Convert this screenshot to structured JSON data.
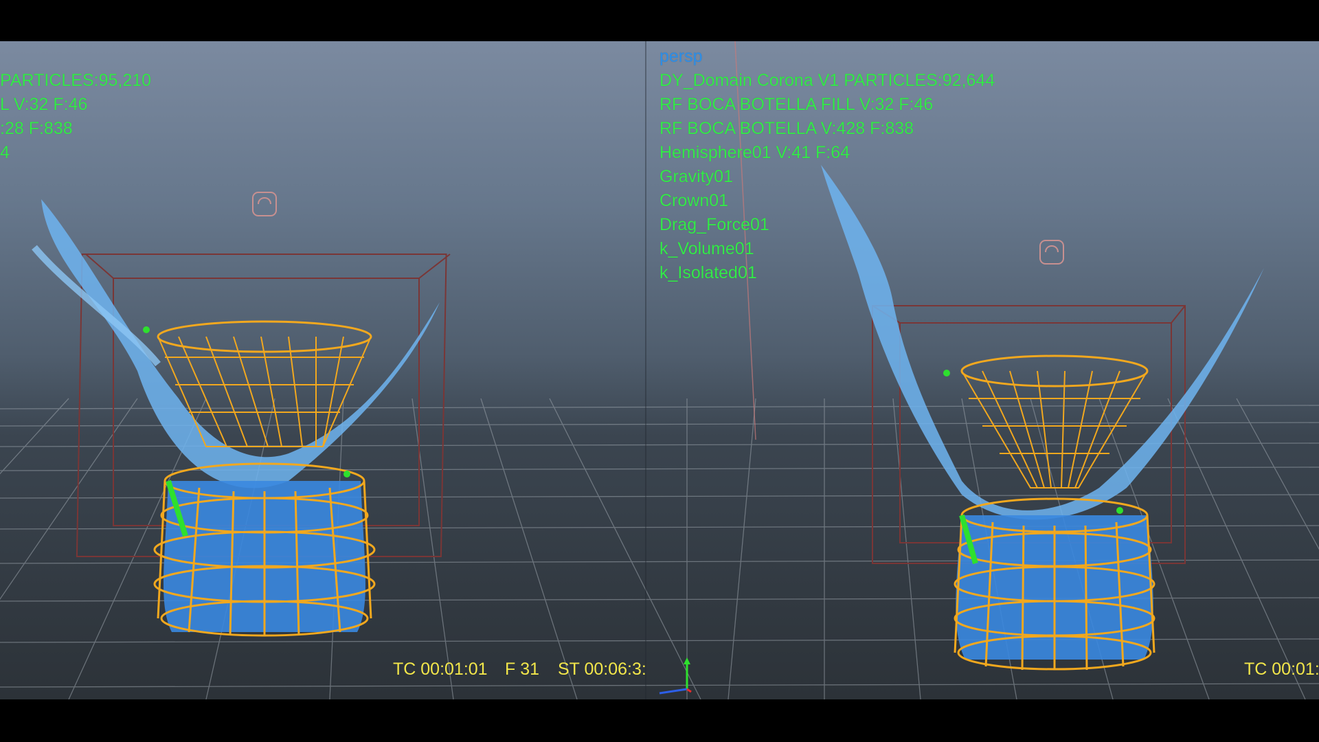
{
  "viewport": {
    "camera_label": "persp",
    "hud_right": [
      "DY_Domain Corona V1 PARTICLES:92,644",
      "RF BOCA BOTELLA FILL V:32 F:46",
      "RF BOCA BOTELLA V:428 F:838",
      "Hemisphere01 V:41 F:64",
      "Gravity01",
      "Crown01",
      "Drag_Force01",
      "k_Volume01",
      "k_Isolated01"
    ],
    "hud_left_cropped": [
      "PARTICLES:95,210",
      "L V:32 F:46",
      ":28 F:838",
      "4"
    ],
    "timecode_left": {
      "tc": "TC 00:01:01",
      "frame": "F 31",
      "st": "ST 00:06:3:"
    },
    "timecode_right": "TC 00:01:"
  },
  "colors": {
    "hud_green": "#34e84a",
    "camera_blue": "#2d8fe8",
    "timecode_yellow": "#f2e64a",
    "wireframe_orange": "#f2a81e",
    "fluid_blue": "#6fb4f0",
    "bbox_red": "#8a3a3a"
  },
  "icons": [
    "emitter-icon",
    "axis-gizmo-icon"
  ]
}
